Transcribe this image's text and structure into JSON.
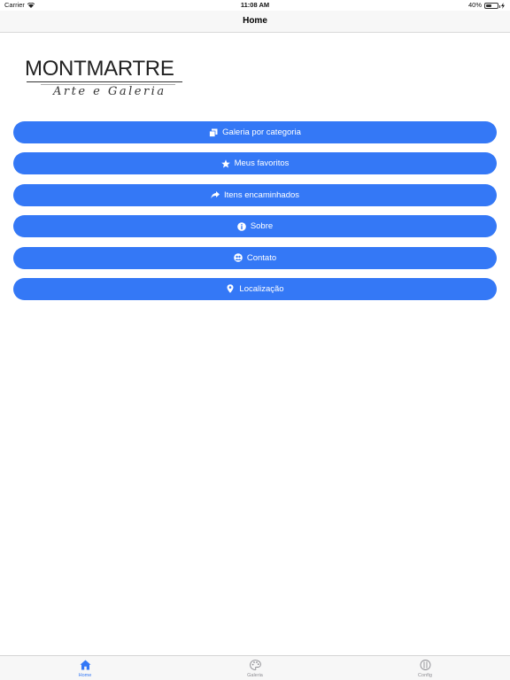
{
  "status_bar": {
    "carrier": "Carrier",
    "time": "11:08 AM",
    "battery_percent": "40%",
    "battery_level": 0.4
  },
  "nav": {
    "title": "Home"
  },
  "logo": {
    "wordmark": "MONTMARTRE",
    "tagline": "Arte e Galeria"
  },
  "menu": [
    {
      "label": "Galeria por categoria",
      "icon": "stacked-images-icon"
    },
    {
      "label": "Meus favoritos",
      "icon": "star-icon"
    },
    {
      "label": "Itens encaminhados",
      "icon": "share-arrow-icon"
    },
    {
      "label": "Sobre",
      "icon": "info-icon"
    },
    {
      "label": "Contato",
      "icon": "contact-icon"
    },
    {
      "label": "Localização",
      "icon": "map-pin-icon"
    }
  ],
  "tabs": [
    {
      "label": "Home",
      "icon": "home-icon",
      "active": true
    },
    {
      "label": "Galeria",
      "icon": "palette-icon",
      "active": false
    },
    {
      "label": "Config",
      "icon": "config-icon",
      "active": false
    }
  ],
  "colors": {
    "accent": "#3478f6",
    "inactive": "#8e8e93"
  }
}
